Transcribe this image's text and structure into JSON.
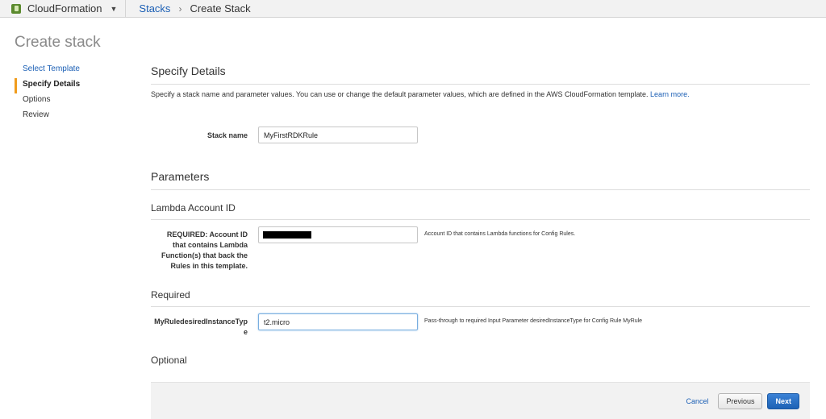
{
  "nav": {
    "service_name": "CloudFormation",
    "service_icon": "cloudformation-icon",
    "breadcrumbs": [
      {
        "label": "Stacks"
      },
      {
        "label": "Create Stack"
      }
    ]
  },
  "page_title": "Create stack",
  "steps": [
    {
      "label": "Select Template"
    },
    {
      "label": "Specify Details"
    },
    {
      "label": "Options"
    },
    {
      "label": "Review"
    }
  ],
  "details": {
    "heading": "Specify Details",
    "description": "Specify a stack name and parameter values. You can use or change the default parameter values, which are defined in the AWS CloudFormation template.",
    "learn_more": "Learn more.",
    "stack_name_label": "Stack name",
    "stack_name_value": "MyFirstRDKRule"
  },
  "parameters": {
    "heading": "Parameters",
    "lambda_group": {
      "heading": "Lambda Account ID",
      "label_lines": [
        "REQUIRED: Account ID",
        "that contains Lambda",
        "Function(s) that back the",
        "Rules in this template."
      ],
      "hint": "Account ID that contains Lambda functions for Config Rules."
    },
    "required_group": {
      "heading": "Required",
      "label_lines": [
        "MyRuledesiredInstanceTyp",
        "e"
      ],
      "value": "t2.micro",
      "hint": "Pass-through to required Input Parameter desiredInstanceType for Config Rule MyRule"
    },
    "optional_heading": "Optional"
  },
  "footer": {
    "cancel": "Cancel",
    "previous": "Previous",
    "next": "Next"
  },
  "colors": {
    "link": "#1b5fb5",
    "active_step_marker": "#f09c1c",
    "primary_button": "#1d62b5"
  }
}
